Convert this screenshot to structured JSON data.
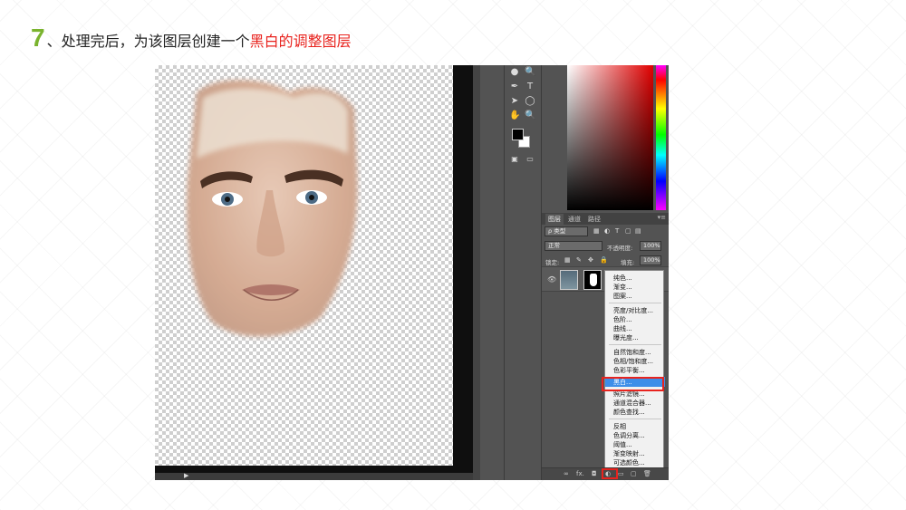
{
  "slide": {
    "step_number": "7",
    "title_plain": "、处理完后，为该图层创建一个",
    "title_highlight": "黑白的调整图层"
  },
  "layers_panel": {
    "tabs": [
      "图层",
      "通道",
      "路径"
    ],
    "filter_label": "ρ 类型",
    "blend_mode": "正常",
    "opacity_label": "不透明度:",
    "opacity_value": "100%",
    "lock_label": "锁定:",
    "fill_label": "填充:",
    "fill_value": "100%"
  },
  "adjustment_menu": {
    "groups": [
      [
        "纯色...",
        "渐变...",
        "图案..."
      ],
      [
        "亮度/对比度...",
        "色阶...",
        "曲线...",
        "曝光度..."
      ],
      [
        "自然饱和度...",
        "色相/饱和度...",
        "色彩平衡...",
        "黑白...",
        "照片滤镜...",
        "通道混合器...",
        "颜色查找..."
      ],
      [
        "反相",
        "色调分离...",
        "阈值...",
        "渐变映射...",
        "可选颜色..."
      ]
    ],
    "selected": "黑白..."
  },
  "colors": {
    "accent_green": "#7ab32e",
    "accent_red": "#e8231e",
    "menu_highlight": "#3d8ee8"
  }
}
